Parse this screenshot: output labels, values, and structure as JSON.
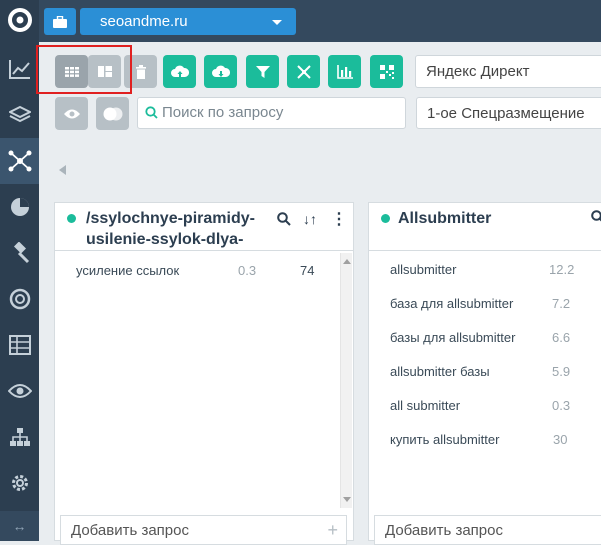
{
  "topbar": {
    "site": "seoandme.ru"
  },
  "toolbar": {
    "view_modes": [
      "grid-view",
      "column-view"
    ],
    "source_select": "Яндекс Директ",
    "search_placeholder": "Поиск по запросу",
    "placement_select": "1-ое Спецразмещение"
  },
  "panels": [
    {
      "title": "/ssylochnye-piramidy-usilenie-ssylok-dlya-",
      "rows": [
        {
          "query": "усиление ссылок",
          "value": "0.3",
          "count": "74"
        }
      ],
      "add_label": "Добавить запрос"
    },
    {
      "title": "Allsubmitter",
      "rows": [
        {
          "query": "allsubmitter",
          "value": "12.2"
        },
        {
          "query": "база для allsubmitter",
          "value": "7.2"
        },
        {
          "query": "базы для allsubmitter",
          "value": "6.6"
        },
        {
          "query": "allsubmitter базы",
          "value": "5.9"
        },
        {
          "query": "all submitter",
          "value": "0.3"
        },
        {
          "query": "купить allsubmitter",
          "value": "30"
        }
      ],
      "add_label": "Добавить запрос"
    }
  ],
  "sidebar": {
    "icons": [
      "logo-icon",
      "chart-icon",
      "layers-icon",
      "network-icon",
      "pie-icon",
      "gavel-icon",
      "lifebuoy-icon",
      "table-icon",
      "eye-icon",
      "sitemap-icon",
      "gear-icon",
      "arrows-icon"
    ]
  },
  "colors": {
    "accent": "#2b8fd6",
    "green": "#1bbc9b",
    "sidebar": "#2c3e50",
    "highlight": "#e02020"
  }
}
